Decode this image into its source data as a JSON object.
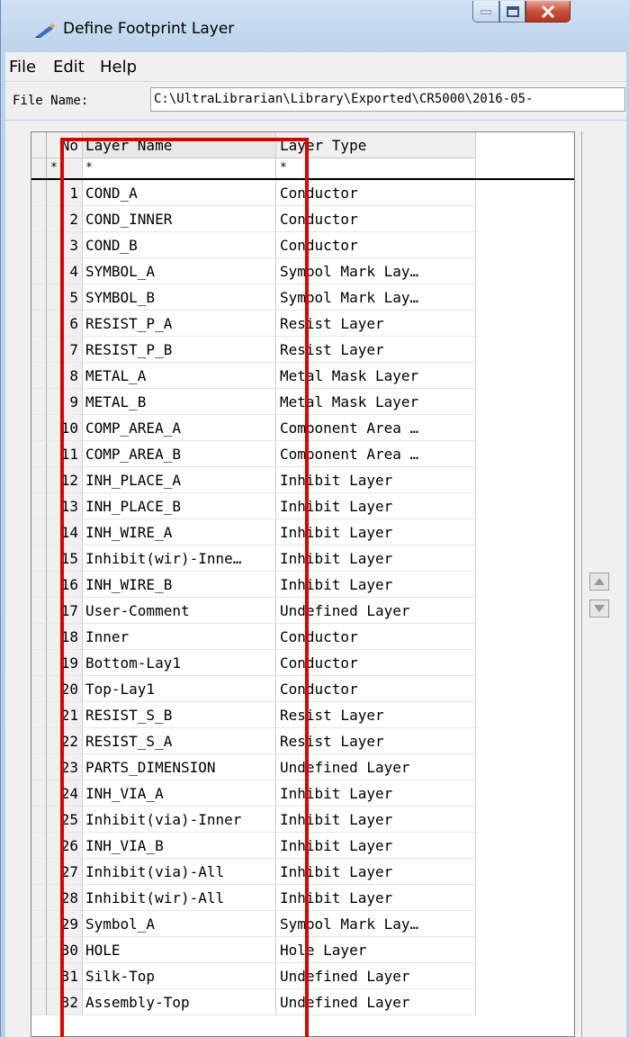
{
  "window": {
    "title": "Define Footprint Layer"
  },
  "menu": {
    "file": "File",
    "edit": "Edit",
    "help": "Help"
  },
  "file_name": {
    "label": "File Name:",
    "value": "C:\\UltraLibrarian\\Library\\Exported\\CR5000\\2016-05-"
  },
  "table": {
    "headers": {
      "no": "No",
      "name": "Layer Name",
      "type": "Layer Type"
    },
    "filter": {
      "no": "*",
      "name": "*",
      "type": "*"
    },
    "rows": [
      {
        "no": "1",
        "name": "COND_A",
        "type": "Conductor"
      },
      {
        "no": "2",
        "name": "COND_INNER",
        "type": "Conductor"
      },
      {
        "no": "3",
        "name": "COND_B",
        "type": "Conductor"
      },
      {
        "no": "4",
        "name": "SYMBOL_A",
        "type": "Symbol Mark Lay…"
      },
      {
        "no": "5",
        "name": "SYMBOL_B",
        "type": "Symbol Mark Lay…"
      },
      {
        "no": "6",
        "name": "RESIST_P_A",
        "type": "Resist Layer"
      },
      {
        "no": "7",
        "name": "RESIST_P_B",
        "type": "Resist Layer"
      },
      {
        "no": "8",
        "name": "METAL_A",
        "type": "Metal Mask Layer"
      },
      {
        "no": "9",
        "name": "METAL_B",
        "type": "Metal Mask Layer"
      },
      {
        "no": "10",
        "name": "COMP_AREA_A",
        "type": "Component Area …"
      },
      {
        "no": "11",
        "name": "COMP_AREA_B",
        "type": "Component Area …"
      },
      {
        "no": "12",
        "name": "INH_PLACE_A",
        "type": "Inhibit Layer"
      },
      {
        "no": "13",
        "name": "INH_PLACE_B",
        "type": "Inhibit Layer"
      },
      {
        "no": "14",
        "name": "INH_WIRE_A",
        "type": "Inhibit Layer"
      },
      {
        "no": "15",
        "name": "Inhibit(wir)-Inne…",
        "type": "Inhibit Layer"
      },
      {
        "no": "16",
        "name": "INH_WIRE_B",
        "type": "Inhibit Layer"
      },
      {
        "no": "17",
        "name": "User-Comment",
        "type": "Undefined Layer"
      },
      {
        "no": "18",
        "name": "Inner",
        "type": "Conductor"
      },
      {
        "no": "19",
        "name": "Bottom-Lay1",
        "type": "Conductor"
      },
      {
        "no": "20",
        "name": "Top-Lay1",
        "type": "Conductor"
      },
      {
        "no": "21",
        "name": "RESIST_S_B",
        "type": "Resist Layer"
      },
      {
        "no": "22",
        "name": "RESIST_S_A",
        "type": "Resist Layer"
      },
      {
        "no": "23",
        "name": "PARTS_DIMENSION",
        "type": "Undefined Layer"
      },
      {
        "no": "24",
        "name": "INH_VIA_A",
        "type": "Inhibit Layer"
      },
      {
        "no": "25",
        "name": "Inhibit(via)-Inner",
        "type": "Inhibit Layer"
      },
      {
        "no": "26",
        "name": "INH_VIA_B",
        "type": "Inhibit Layer"
      },
      {
        "no": "27",
        "name": "Inhibit(via)-All",
        "type": "Inhibit Layer"
      },
      {
        "no": "28",
        "name": "Inhibit(wir)-All",
        "type": "Inhibit Layer"
      },
      {
        "no": "29",
        "name": "Symbol_A",
        "type": "Symbol Mark Lay…"
      },
      {
        "no": "30",
        "name": "HOLE",
        "type": "Hole Layer"
      },
      {
        "no": "31",
        "name": "Silk-Top",
        "type": "Undefined Layer"
      },
      {
        "no": "32",
        "name": "Assembly-Top",
        "type": "Undefined Layer"
      }
    ]
  },
  "icons": {
    "app": "pen-icon",
    "minimize": "minimize-icon",
    "maximize": "maximize-icon",
    "close": "close-icon",
    "scroll_up": "arrow-up-icon",
    "scroll_down": "arrow-down-icon"
  },
  "colors": {
    "highlight": "#e00000",
    "close_button": "#c8513a"
  }
}
